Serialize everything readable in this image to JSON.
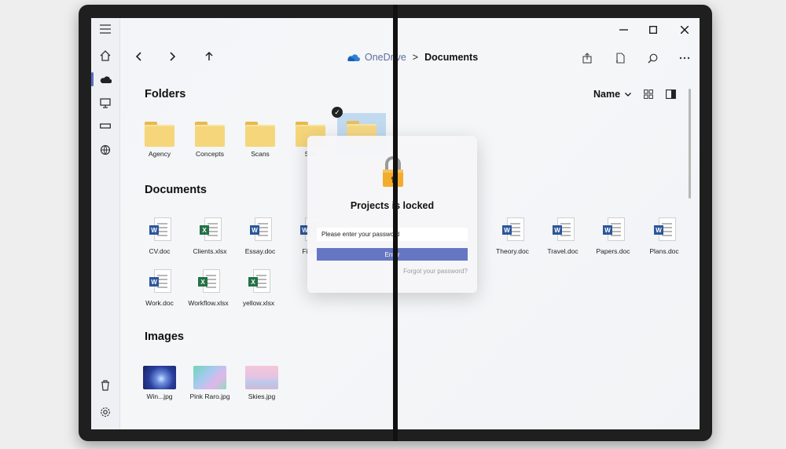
{
  "breadcrumb": {
    "root": "OneDrive",
    "separator": ">",
    "current": "Documents"
  },
  "window_controls": {
    "minimize": "—",
    "maximize": "☐",
    "close": "✕"
  },
  "nav": {
    "back": "‹",
    "forward": "›",
    "up": "↑"
  },
  "sort": {
    "label": "Name"
  },
  "sections": {
    "folders": "Folders",
    "documents": "Documents",
    "images": "Images"
  },
  "folders": [
    {
      "name": "Agency"
    },
    {
      "name": "Concepts"
    },
    {
      "name": "Scans"
    },
    {
      "name": "Ske"
    }
  ],
  "documents": [
    {
      "name": "CV.doc",
      "type": "word"
    },
    {
      "name": "Clients.xlsx",
      "type": "excel"
    },
    {
      "name": "Essay.doc",
      "type": "word"
    },
    {
      "name": "File F",
      "type": "word"
    },
    {
      "name": "Theory.doc",
      "type": "word"
    },
    {
      "name": "Travel.doc",
      "type": "word"
    },
    {
      "name": "Papers.doc",
      "type": "word"
    },
    {
      "name": "Plans.doc",
      "type": "word"
    },
    {
      "name": "Work.doc",
      "type": "word"
    },
    {
      "name": "Workflow.xlsx",
      "type": "excel"
    },
    {
      "name": "yellow.xlsx",
      "type": "excel"
    }
  ],
  "images": [
    {
      "name": "Win...jpg"
    },
    {
      "name": "Pink Raro.jpg"
    },
    {
      "name": "Skies.jpg"
    }
  ],
  "dialog": {
    "title": "Projects is locked",
    "password_placeholder": "Please enter your password",
    "enter_label": "Enter",
    "forgot_label": "Forgot your password?"
  },
  "colors": {
    "accent": "#6576c2",
    "word": "#2b579a",
    "excel": "#217346",
    "folder": "#f6d67a"
  }
}
